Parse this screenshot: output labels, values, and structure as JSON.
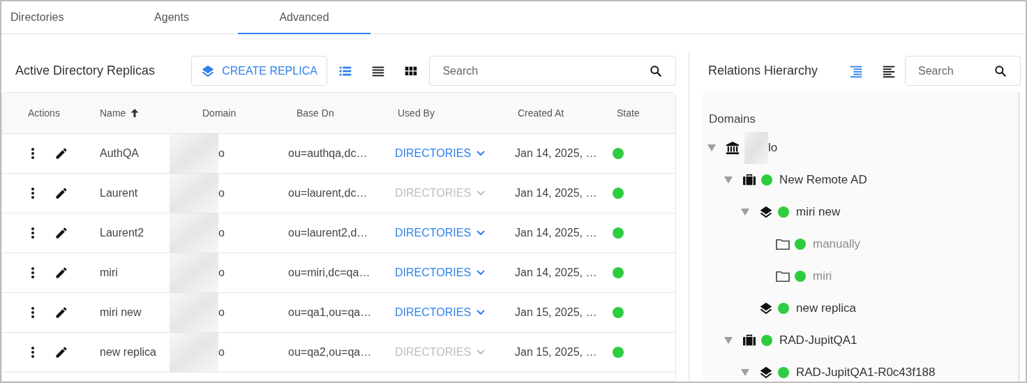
{
  "tabs": [
    {
      "label": "Directories",
      "selected": false
    },
    {
      "label": "Agents",
      "selected": false
    },
    {
      "label": "Advanced",
      "selected": true
    }
  ],
  "replicas": {
    "title": "Active Directory Replicas",
    "create_button": "CREATE REPLICA",
    "view_modes": [
      {
        "kind": "cards",
        "selected": true
      },
      {
        "kind": "list",
        "selected": false
      },
      {
        "kind": "grid",
        "selected": false
      }
    ],
    "search": {
      "placeholder": "Search"
    },
    "table": {
      "columns": [
        {
          "label": "Actions"
        },
        {
          "label": "Name",
          "sorted": true
        },
        {
          "label": "Domain"
        },
        {
          "label": "Base Dn"
        },
        {
          "label": "Used By"
        },
        {
          "label": "Created At"
        },
        {
          "label": "State"
        }
      ],
      "rows": [
        {
          "name": "AuthQA",
          "domain": "o",
          "base_dn": "ou=authqa,dc…",
          "used_by": "DIRECTORIES",
          "used_by_disabled": false,
          "created_at": "Jan 14, 2025, …",
          "color": "#2ecc40"
        },
        {
          "name": "Laurent",
          "domain": "o",
          "base_dn": "ou=laurent,dc…",
          "used_by": "DIRECTORIES",
          "used_by_disabled": true,
          "created_at": "Jan 14, 2025, …",
          "color": "#2ecc40"
        },
        {
          "name": "Laurent2",
          "domain": "o",
          "base_dn": "ou=laurent2,d…",
          "used_by": "DIRECTORIES",
          "used_by_disabled": false,
          "created_at": "Jan 14, 2025, …",
          "color": "#2ecc40"
        },
        {
          "name": "miri",
          "domain": "o",
          "base_dn": "ou=miri,dc=qa…",
          "used_by": "DIRECTORIES",
          "used_by_disabled": false,
          "created_at": "Jan 14, 2025, …",
          "color": "#2ecc40"
        },
        {
          "name": "miri new",
          "domain": "o",
          "base_dn": "ou=qa1,ou=qa…",
          "used_by": "DIRECTORIES",
          "used_by_disabled": false,
          "created_at": "Jan 15, 2025, …",
          "color": "#2ecc40"
        },
        {
          "name": "new replica",
          "domain": "o",
          "base_dn": "ou=qa2,ou=qa…",
          "used_by": "DIRECTORIES",
          "used_by_disabled": true,
          "created_at": "Jan 15, 2025, …",
          "color": "#2ecc40"
        }
      ]
    }
  },
  "hierarchy": {
    "title": "Relations Hierarchy",
    "view_modes": [
      {
        "kind": "indented",
        "selected": true
      },
      {
        "kind": "flat",
        "selected": false
      }
    ],
    "search": {
      "placeholder": "Search"
    },
    "heading": "Domains",
    "tree": [
      {
        "kind": "domain",
        "label": "lo",
        "expanded": true,
        "children": [
          {
            "kind": "agent",
            "label": "New Remote AD",
            "color": "#2ecc40",
            "expanded": true,
            "children": [
              {
                "kind": "replica",
                "label": "miri new",
                "color": "#2ecc40",
                "expanded": true,
                "children": [
                  {
                    "kind": "folder",
                    "label": "manually",
                    "color": "#2ecc40"
                  },
                  {
                    "kind": "folder",
                    "label": "miri",
                    "color": "#2ecc40"
                  }
                ]
              },
              {
                "kind": "replica",
                "label": "new replica",
                "color": "#2ecc40"
              }
            ]
          },
          {
            "kind": "agent",
            "label": "RAD-JupitQA1",
            "color": "#2ecc40",
            "expanded": true,
            "children": [
              {
                "kind": "replica",
                "label": "RAD-JupitQA1-R0c43f188",
                "color": "#2ecc40",
                "expanded": true
              }
            ]
          }
        ]
      }
    ]
  }
}
